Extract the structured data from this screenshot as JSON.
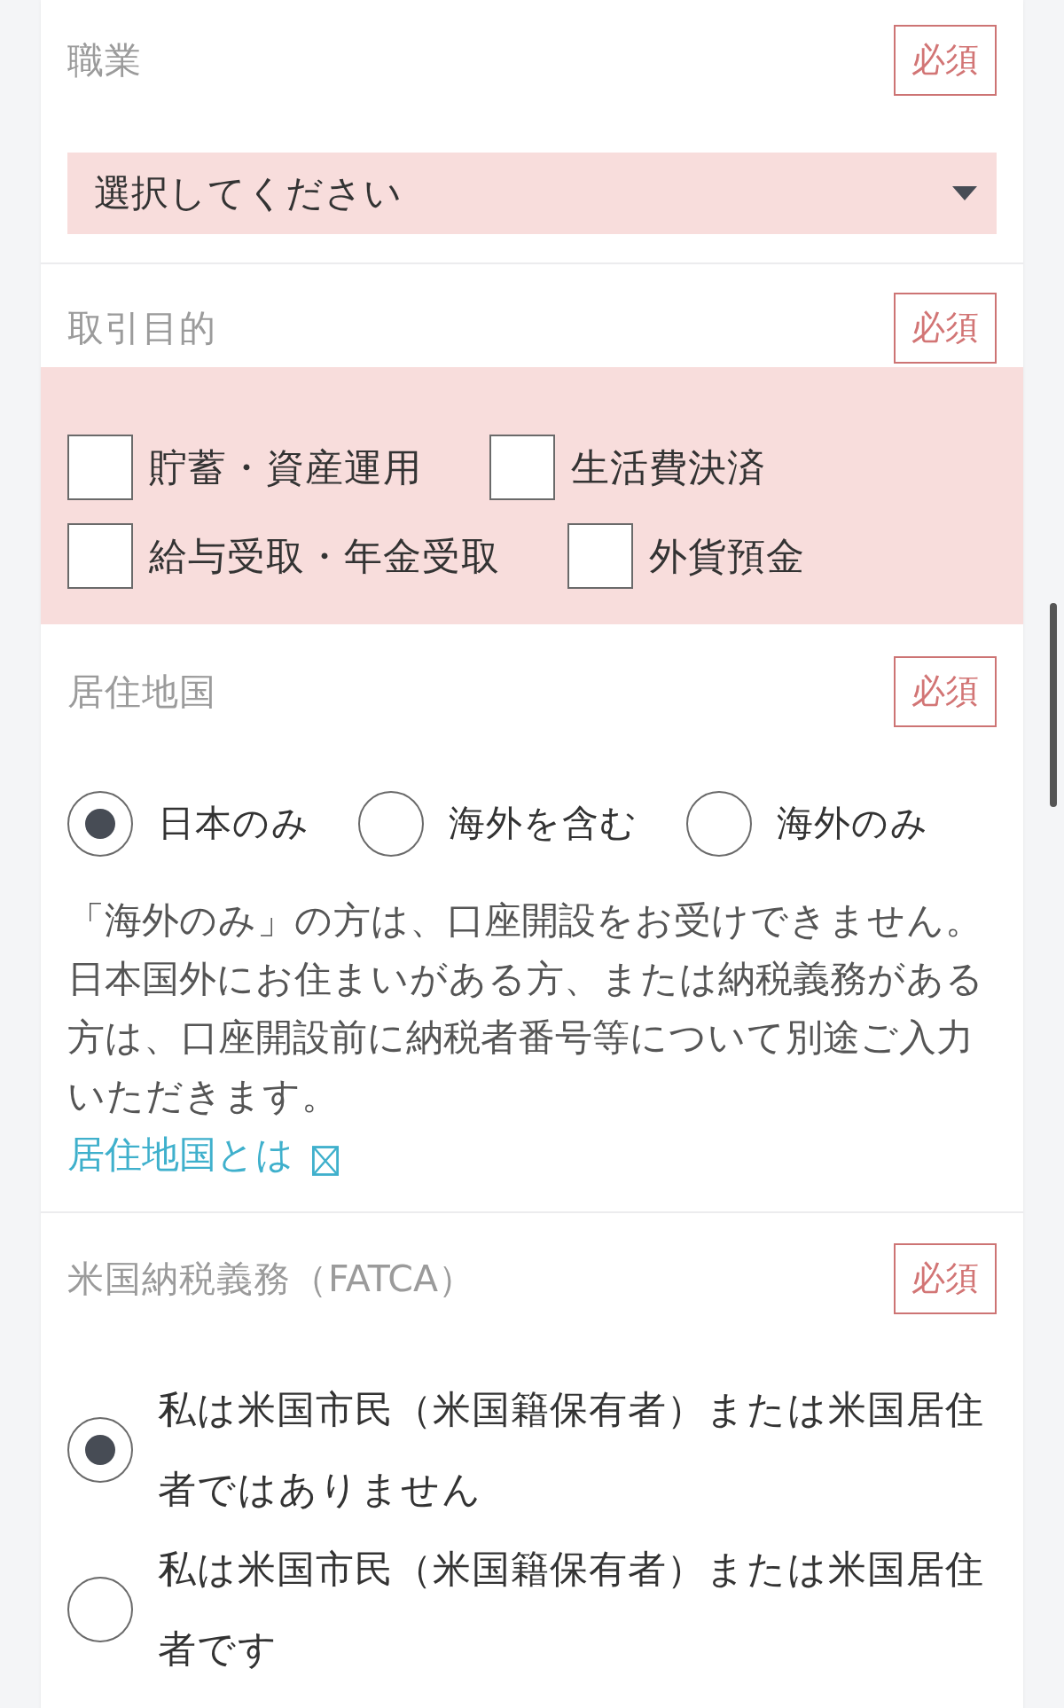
{
  "sections": [
    {
      "kind": "select",
      "label": "職業",
      "badge": "必須",
      "error": true,
      "select": {
        "placeholder": "選択してください"
      }
    },
    {
      "kind": "checkboxes",
      "label": "取引目的",
      "badge": "必須",
      "error": true,
      "options": [
        {
          "label": "貯蓄・資産運用",
          "checked": false
        },
        {
          "label": "生活費決済",
          "checked": false
        },
        {
          "label": "給与受取・年金受取",
          "checked": false
        },
        {
          "label": "外貨預金",
          "checked": false
        }
      ]
    },
    {
      "kind": "radio-row",
      "label": "居住地国",
      "badge": "必須",
      "error": false,
      "options": [
        {
          "label": "日本のみ",
          "selected": true
        },
        {
          "label": "海外を含む",
          "selected": false
        },
        {
          "label": "海外のみ",
          "selected": false
        }
      ],
      "note": "「海外のみ」の方は、口座開設をお受けできません。日本国外にお住まいがある方、または納税義務がある方は、口座開設前に納税者番号等について別途ご入力いただきます。",
      "link": "居住地国とは"
    },
    {
      "kind": "radio-list",
      "label": "米国納税義務（FATCA）",
      "badge": "必須",
      "error": false,
      "options": [
        {
          "label": "私は米国市民（米国籍保有者）または米国居住者ではありません",
          "selected": true
        },
        {
          "label": "私は米国市民（米国籍保有者）または米国居住者です",
          "selected": false
        }
      ]
    }
  ]
}
